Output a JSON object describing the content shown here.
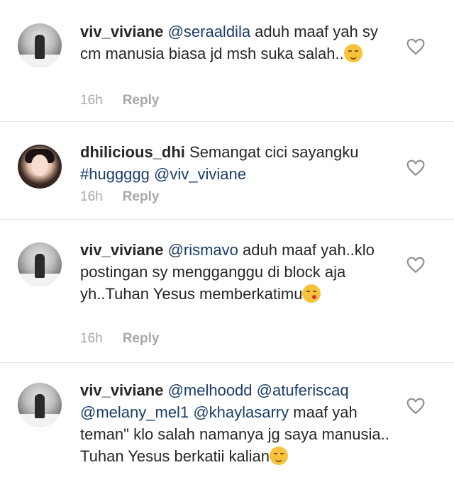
{
  "comments": [
    {
      "username": "viv_viviane",
      "mention": "@seraaldila",
      "text": " aduh maaf yah sy cm manusia biasa jd msh suka salah..",
      "emoji": "smiling-face",
      "time": "16h",
      "reply": "Reply"
    },
    {
      "username": "dhilicious_dhi",
      "text": " Semangat cici sayangku ",
      "hashtag": "#huggggg",
      "mention": "@viv_viviane",
      "time": "16h",
      "reply": "Reply"
    },
    {
      "username": "viv_viviane",
      "mention": "@rismavo",
      "text": " aduh maaf yah..klo postingan sy mengganggu di block aja yh..Tuhan Yesus memberkatimu",
      "emoji": "kissing-face",
      "time": "16h",
      "reply": "Reply"
    },
    {
      "username": "viv_viviane",
      "mention1": "@melhoodd",
      "mention2": "@atuferiscaq",
      "mention3": "@melany_mel1",
      "mention4": "@khaylasarry",
      "text": " maaf yah teman\" klo salah namanya jg saya manusia.. Tuhan Yesus berkatii kalian",
      "emoji": "smiling-face"
    }
  ],
  "icons": {
    "like": "heart-outline-icon"
  }
}
